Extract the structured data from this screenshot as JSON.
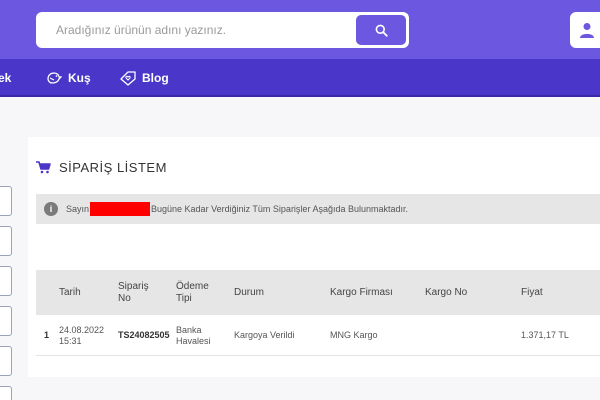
{
  "header": {
    "search": {
      "placeholder": "Aradığınız ürünün adını yazınız.",
      "value": ""
    }
  },
  "nav": {
    "items": [
      {
        "label": "ek",
        "icon": "partial"
      },
      {
        "label": "Kuş",
        "icon": "bird-icon"
      },
      {
        "label": "Blog",
        "icon": "tag-heart-icon"
      }
    ]
  },
  "page": {
    "title": "SİPARİŞ LİSTEM",
    "alert": {
      "prefix": "Sayın",
      "suffix": "Bugüne Kadar Verdiğiniz Tüm Siparişler Aşağıda Bulunmaktadır."
    }
  },
  "orders_table": {
    "headers": [
      "Tarih",
      "Sipariş No",
      "Ödeme Tipi",
      "Durum",
      "Kargo Firması",
      "Kargo No",
      "Fiyat"
    ],
    "rows": [
      {
        "index": "1",
        "date": "24.08.2022 15:31",
        "order_no": "TS24082505",
        "payment": "Banka Havalesi",
        "status": "Kargoya Verildi",
        "carrier": "MNG Kargo",
        "tracking": "",
        "price": "1.371,17 TL"
      }
    ]
  },
  "colors": {
    "header": "#6c57e0",
    "nav": "#4a36c8",
    "redaction": "#ff0000"
  }
}
